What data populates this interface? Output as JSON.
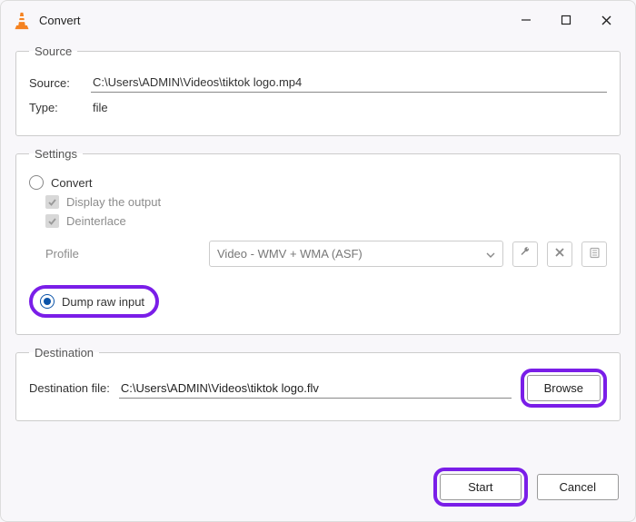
{
  "window": {
    "title": "Convert"
  },
  "source": {
    "legend": "Source",
    "source_label": "Source:",
    "source_value": "C:\\Users\\ADMIN\\Videos\\tiktok logo.mp4",
    "type_label": "Type:",
    "type_value": "file"
  },
  "settings": {
    "legend": "Settings",
    "convert_label": "Convert",
    "display_output_label": "Display the output",
    "deinterlace_label": "Deinterlace",
    "profile_label": "Profile",
    "profile_value": "Video - WMV + WMA (ASF)",
    "dump_raw_label": "Dump raw input"
  },
  "destination": {
    "legend": "Destination",
    "dest_label": "Destination file:",
    "dest_value": "C:\\Users\\ADMIN\\Videos\\tiktok logo.flv",
    "browse_label": "Browse"
  },
  "footer": {
    "start_label": "Start",
    "cancel_label": "Cancel"
  }
}
